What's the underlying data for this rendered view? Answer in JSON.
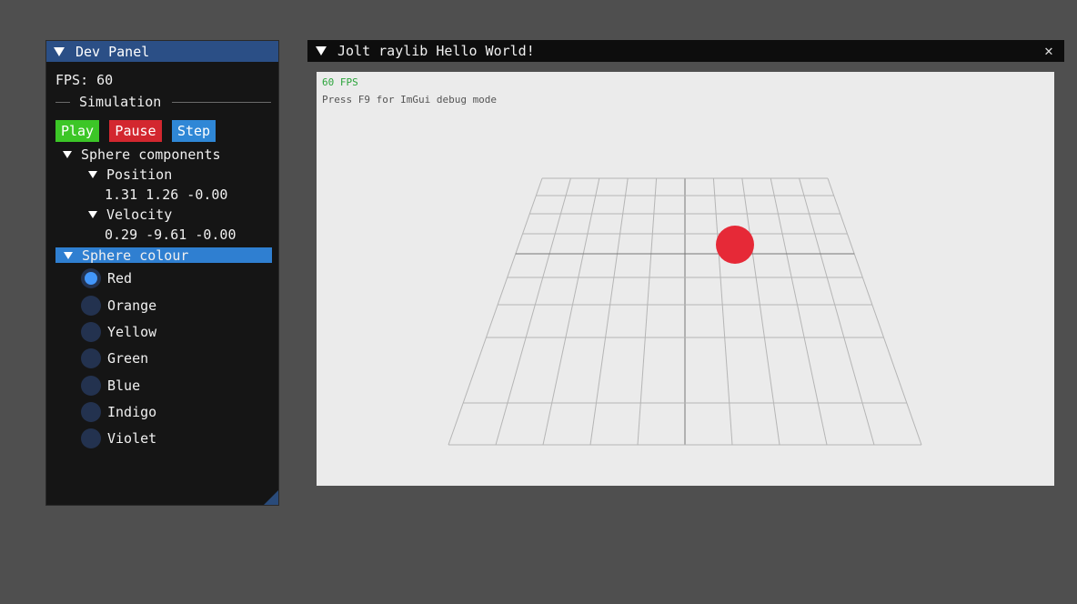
{
  "dev_panel": {
    "title": "Dev Panel",
    "fps_text": "FPS: 60",
    "separator_label": "Simulation",
    "buttons": {
      "play": "Play",
      "pause": "Pause",
      "step": "Step"
    },
    "sphere_components": {
      "label": "Sphere components",
      "position_label": "Position",
      "position_value": "1.31 1.26 -0.00",
      "velocity_label": "Velocity",
      "velocity_value": "0.29 -9.61 -0.00"
    },
    "sphere_colour": {
      "label": "Sphere colour",
      "options": [
        "Red",
        "Orange",
        "Yellow",
        "Green",
        "Blue",
        "Indigo",
        "Violet"
      ],
      "selected": "Red"
    }
  },
  "viewport_window": {
    "title": "Jolt raylib Hello World!",
    "close_icon": "close-icon",
    "fps_label": "60 FPS",
    "hint": "Press F9 for ImGui debug mode"
  },
  "colors": {
    "play": "#3cc627",
    "pause": "#d3272f",
    "step": "#2f87d6",
    "sphere": "#e62937",
    "header_active": "#2f7fd1"
  }
}
